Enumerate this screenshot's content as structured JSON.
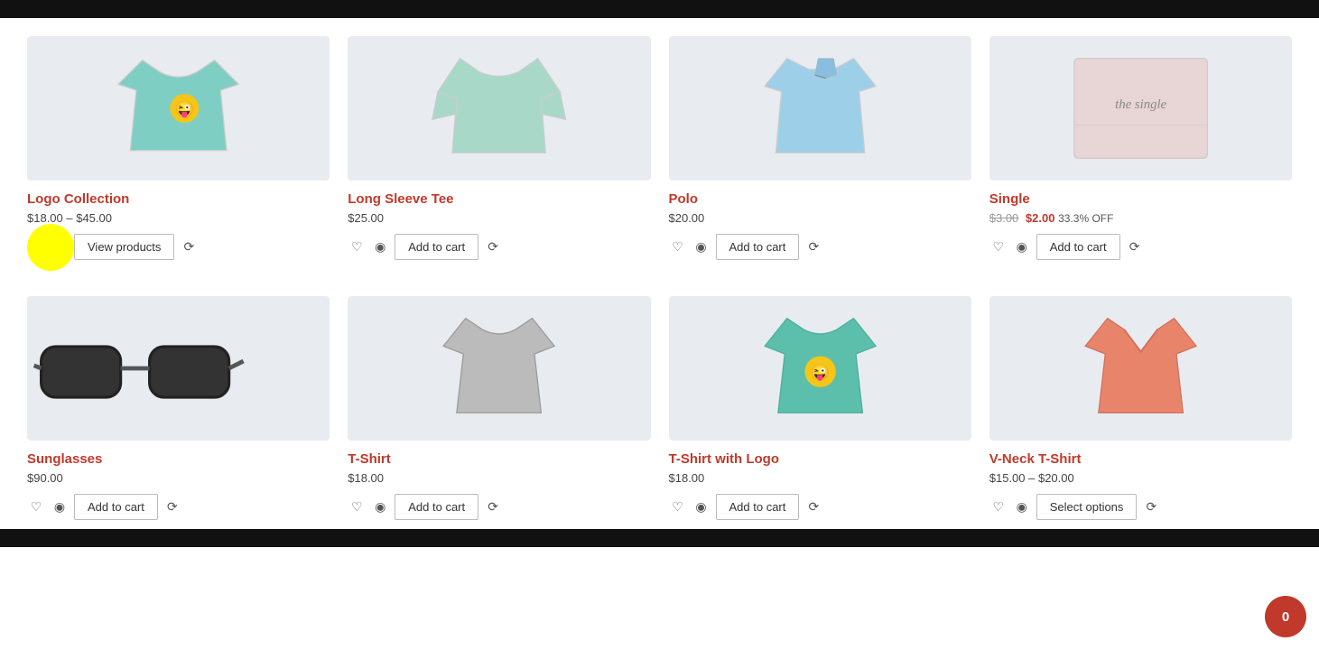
{
  "topRow": [
    {
      "id": "logo-collection",
      "name": "Logo Collection",
      "price": "$18.00 – $45.00",
      "priceOld": null,
      "priceNew": null,
      "priceOff": null,
      "action": "view_products",
      "actionLabel": "View products",
      "imageType": "logo-tshirt"
    },
    {
      "id": "long-sleeve-tee",
      "name": "Long Sleeve Tee",
      "price": "$25.00",
      "priceOld": null,
      "priceNew": null,
      "priceOff": null,
      "action": "add_to_cart",
      "actionLabel": "Add to cart",
      "imageType": "long-sleeve"
    },
    {
      "id": "polo",
      "name": "Polo",
      "price": "$20.00",
      "priceOld": null,
      "priceNew": null,
      "priceOff": null,
      "action": "add_to_cart",
      "actionLabel": "Add to cart",
      "imageType": "polo"
    },
    {
      "id": "single",
      "name": "Single",
      "price": null,
      "priceOld": "$3.00",
      "priceNew": "$2.00",
      "priceOff": "33.3% OFF",
      "action": "add_to_cart",
      "actionLabel": "Add to cart",
      "imageType": "single"
    }
  ],
  "bottomRow": [
    {
      "id": "sunglasses",
      "name": "Sunglasses",
      "price": "$90.00",
      "priceOld": null,
      "priceNew": null,
      "priceOff": null,
      "action": "add_to_cart",
      "actionLabel": "Add to cart",
      "imageType": "sunglasses"
    },
    {
      "id": "t-shirt",
      "name": "T-Shirt",
      "price": "$18.00",
      "priceOld": null,
      "priceNew": null,
      "priceOff": null,
      "action": "add_to_cart",
      "actionLabel": "Add to cart",
      "imageType": "plain-tshirt"
    },
    {
      "id": "t-shirt-logo",
      "name": "T-Shirt with Logo",
      "price": "$18.00",
      "priceOld": null,
      "priceNew": null,
      "priceOff": null,
      "action": "add_to_cart",
      "actionLabel": "Add to cart",
      "imageType": "logo-tshirt-green"
    },
    {
      "id": "v-neck-tshirt",
      "name": "V-Neck T-Shirt",
      "price": "$15.00 – $20.00",
      "priceOld": null,
      "priceNew": null,
      "priceOff": null,
      "action": "select_options",
      "actionLabel": "Select options",
      "imageType": "vneck-tshirt"
    }
  ],
  "cart": {
    "count": "0"
  },
  "icons": {
    "heart": "♡",
    "eye": "◉",
    "refresh": "⟳"
  }
}
